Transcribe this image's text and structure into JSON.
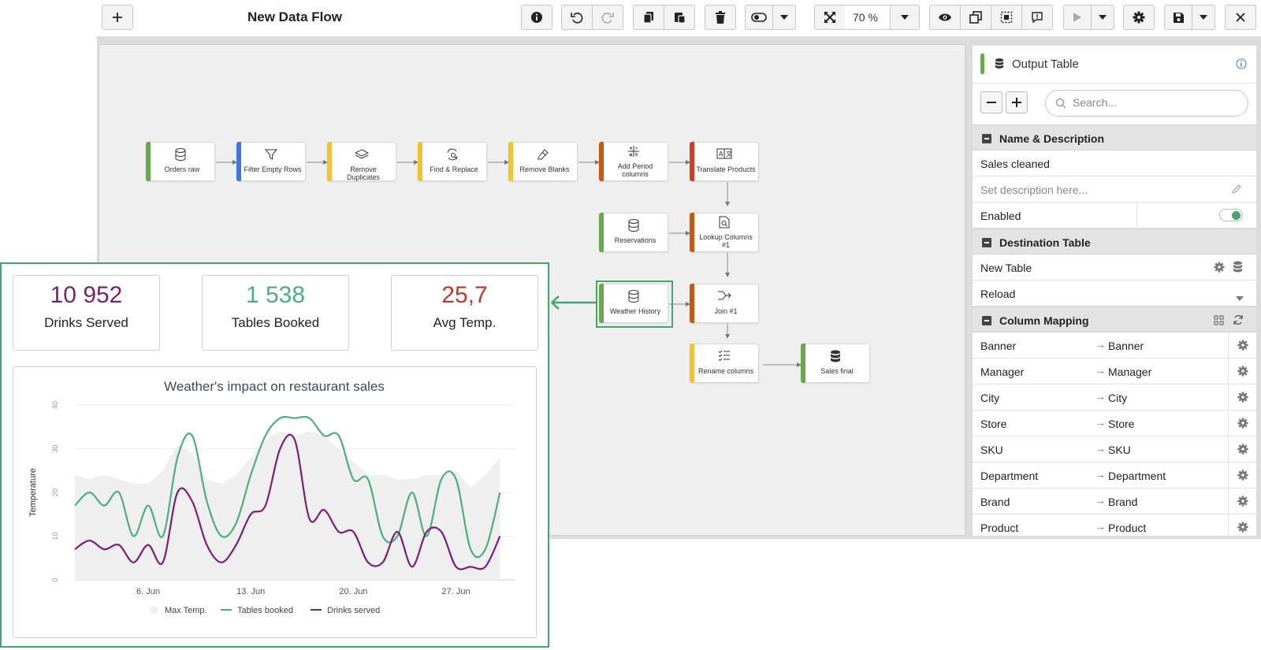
{
  "toolbar": {
    "title": "New Data Flow",
    "zoom": "70 %"
  },
  "flow": {
    "nodes": [
      {
        "id": "orders",
        "label": "Orders raw",
        "color": "#6aa84f",
        "icon": "database-icon"
      },
      {
        "id": "filter",
        "label": "Filter Empty Rows",
        "color": "#3c78d8",
        "icon": "filter-icon"
      },
      {
        "id": "dups",
        "label": "Remove Duplicates",
        "color": "#f1c232",
        "icon": "layers-icon"
      },
      {
        "id": "find",
        "label": "Find & Replace",
        "color": "#f1c232",
        "icon": "find-replace-icon"
      },
      {
        "id": "blanks",
        "label": "Remove Blanks",
        "color": "#f1c232",
        "icon": "eraser-icon"
      },
      {
        "id": "period",
        "label": "Add Period columns",
        "color": "#c55a11",
        "icon": "calculator-icon"
      },
      {
        "id": "translate",
        "label": "Translate Products",
        "color": "#cc4125",
        "icon": "translate-icon"
      },
      {
        "id": "reservations",
        "label": "Reservations",
        "color": "#6aa84f",
        "icon": "database-icon"
      },
      {
        "id": "lookup",
        "label": "Lookup Columns #1",
        "color": "#c55a11",
        "icon": "file-search-icon"
      },
      {
        "id": "weather",
        "label": "Weather History",
        "color": "#6aa84f",
        "icon": "database-icon"
      },
      {
        "id": "join",
        "label": "Join #1",
        "color": "#c55a11",
        "icon": "join-icon"
      },
      {
        "id": "rename",
        "label": "Rename columns",
        "color": "#f1c232",
        "icon": "list-check-icon"
      },
      {
        "id": "final",
        "label": "Sales final",
        "color": "#6aa84f",
        "icon": "database-filled-icon"
      }
    ]
  },
  "panel": {
    "title": "Output Table",
    "search_placeholder": "Search...",
    "name_section": "Name & Description",
    "name_value": "Sales cleaned",
    "description_placeholder": "Set description here...",
    "enabled_label": "Enabled",
    "enabled": true,
    "destination_section": "Destination Table",
    "destination_value": "New Table",
    "mode_value": "Reload",
    "mapping_section": "Column Mapping",
    "mappings": [
      {
        "src": "Banner",
        "dst": "Banner"
      },
      {
        "src": "Manager",
        "dst": "Manager"
      },
      {
        "src": "City",
        "dst": "City"
      },
      {
        "src": "Store",
        "dst": "Store"
      },
      {
        "src": "SKU",
        "dst": "SKU"
      },
      {
        "src": "Department",
        "dst": "Department"
      },
      {
        "src": "Brand",
        "dst": "Brand"
      },
      {
        "src": "Product",
        "dst": "Product"
      }
    ]
  },
  "dashboard": {
    "kpis": [
      {
        "value": "10 952",
        "label": "Drinks Served",
        "color": "#7b1f74"
      },
      {
        "value": "1 538",
        "label": "Tables Booked",
        "color": "#4caf7d"
      },
      {
        "value": "25,7",
        "label": "Avg Temp.",
        "color": "#c0392b"
      }
    ]
  },
  "chart_data": {
    "type": "line",
    "title": "Weather's impact on restaurant sales",
    "xlabel": "",
    "ylabel": "Temperature",
    "ylim": [
      0,
      40
    ],
    "yticks": [
      0,
      10,
      20,
      30,
      40
    ],
    "xlim": [
      1,
      31
    ],
    "xticks": [
      {
        "x": 6,
        "label": "6. Jun"
      },
      {
        "x": 13,
        "label": "13. Jun"
      },
      {
        "x": 20,
        "label": "20. Jun"
      },
      {
        "x": 27,
        "label": "27. Jun"
      }
    ],
    "x": [
      1,
      2,
      3,
      4,
      5,
      6,
      7,
      8,
      9,
      10,
      11,
      12,
      13,
      14,
      15,
      16,
      17,
      18,
      19,
      20,
      21,
      22,
      23,
      24,
      25,
      26,
      27,
      28,
      29,
      30
    ],
    "series": [
      {
        "name": "Max Temp.",
        "type": "area",
        "color": "#efefef",
        "values": [
          24,
          23,
          24,
          23,
          22,
          22,
          25,
          31,
          29,
          23,
          22,
          24,
          28,
          32,
          34,
          33,
          34,
          33,
          30,
          27,
          24,
          24,
          23,
          23,
          24,
          24,
          25,
          21,
          24,
          28
        ]
      },
      {
        "name": "Tables booked",
        "type": "line",
        "color": "#4caf7d",
        "values": [
          17,
          20,
          17,
          20,
          10,
          17,
          10,
          28,
          33,
          18,
          10,
          13,
          24,
          33,
          37,
          37,
          37,
          33,
          33,
          23,
          23,
          10,
          10,
          20,
          10,
          23,
          23,
          7,
          7,
          20
        ]
      },
      {
        "name": "Drinks served",
        "type": "line",
        "color": "#7b1f74",
        "values": [
          7,
          9,
          7,
          8,
          4,
          8,
          4,
          20,
          18,
          8,
          4,
          8,
          15,
          17,
          30,
          32,
          14,
          16,
          11,
          11,
          4,
          4,
          11,
          3,
          11,
          11,
          3,
          3,
          3,
          10
        ]
      }
    ],
    "legend": "bottom",
    "grid": true
  }
}
